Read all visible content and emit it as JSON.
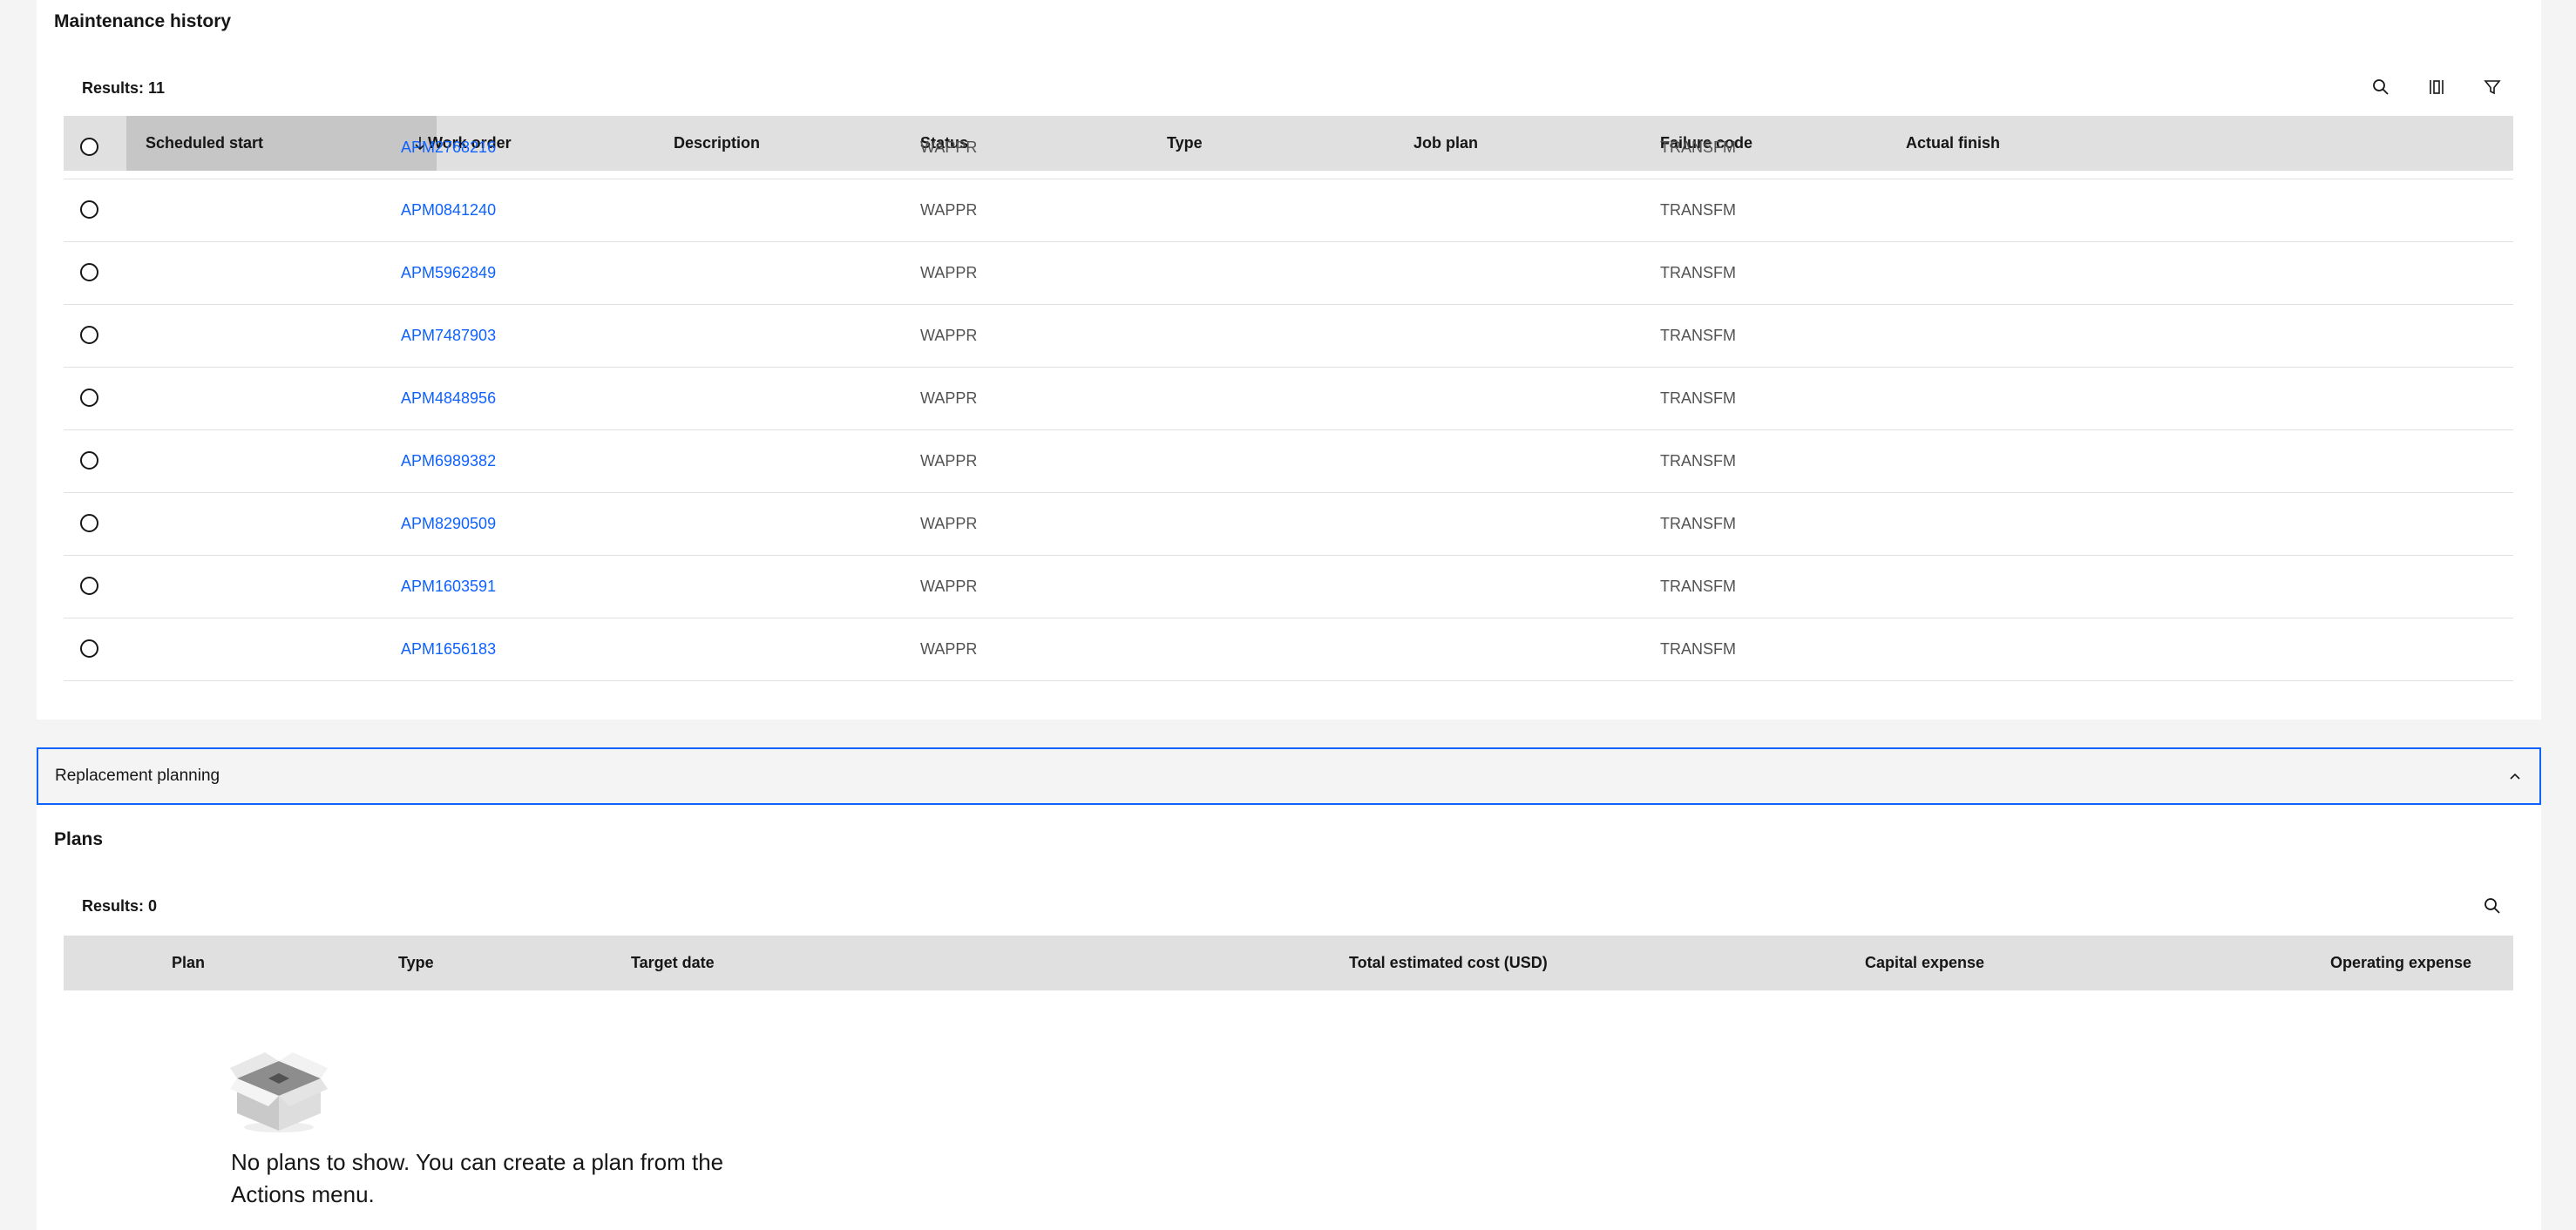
{
  "maintenance_history": {
    "title": "Maintenance history",
    "results": "Results: 11",
    "columns": {
      "scheduled_start": "Scheduled start",
      "work_order": "Work order",
      "description": "Description",
      "status": "Status",
      "type": "Type",
      "job_plan": "Job plan",
      "failure_code": "Failure code",
      "actual_finish": "Actual finish"
    },
    "rows": [
      {
        "work_order": "APM2768216",
        "status": "WAPPR",
        "failure_code": "TRANSFM"
      },
      {
        "work_order": "APM0841240",
        "status": "WAPPR",
        "failure_code": "TRANSFM"
      },
      {
        "work_order": "APM5962849",
        "status": "WAPPR",
        "failure_code": "TRANSFM"
      },
      {
        "work_order": "APM7487903",
        "status": "WAPPR",
        "failure_code": "TRANSFM"
      },
      {
        "work_order": "APM4848956",
        "status": "WAPPR",
        "failure_code": "TRANSFM"
      },
      {
        "work_order": "APM6989382",
        "status": "WAPPR",
        "failure_code": "TRANSFM"
      },
      {
        "work_order": "APM8290509",
        "status": "WAPPR",
        "failure_code": "TRANSFM"
      },
      {
        "work_order": "APM1603591",
        "status": "WAPPR",
        "failure_code": "TRANSFM"
      },
      {
        "work_order": "APM1656183",
        "status": "WAPPR",
        "failure_code": "TRANSFM"
      }
    ],
    "toolbar_icons": [
      "search-icon",
      "column-settings-icon",
      "filter-icon"
    ],
    "sort": "descending"
  },
  "replacement_planning": {
    "title": "Replacement planning",
    "expanded": true
  },
  "plans": {
    "title": "Plans",
    "results": "Results: 0",
    "columns": {
      "plan": "Plan",
      "type": "Type",
      "target_date": "Target date",
      "total_estimated_cost": "Total estimated cost (USD)",
      "capital_expense": "Capital expense",
      "operating_expense": "Operating expense"
    },
    "empty_message": "No plans to show. You can create a plan from the Actions menu.",
    "empty_icon": "empty-box-icon"
  },
  "colors": {
    "link": "#0f62fe",
    "header_bg": "#e0e0e0",
    "sorted_header_bg": "#c6c6c6",
    "focus_border": "#0f62fe",
    "page_bg": "#f4f4f4"
  }
}
